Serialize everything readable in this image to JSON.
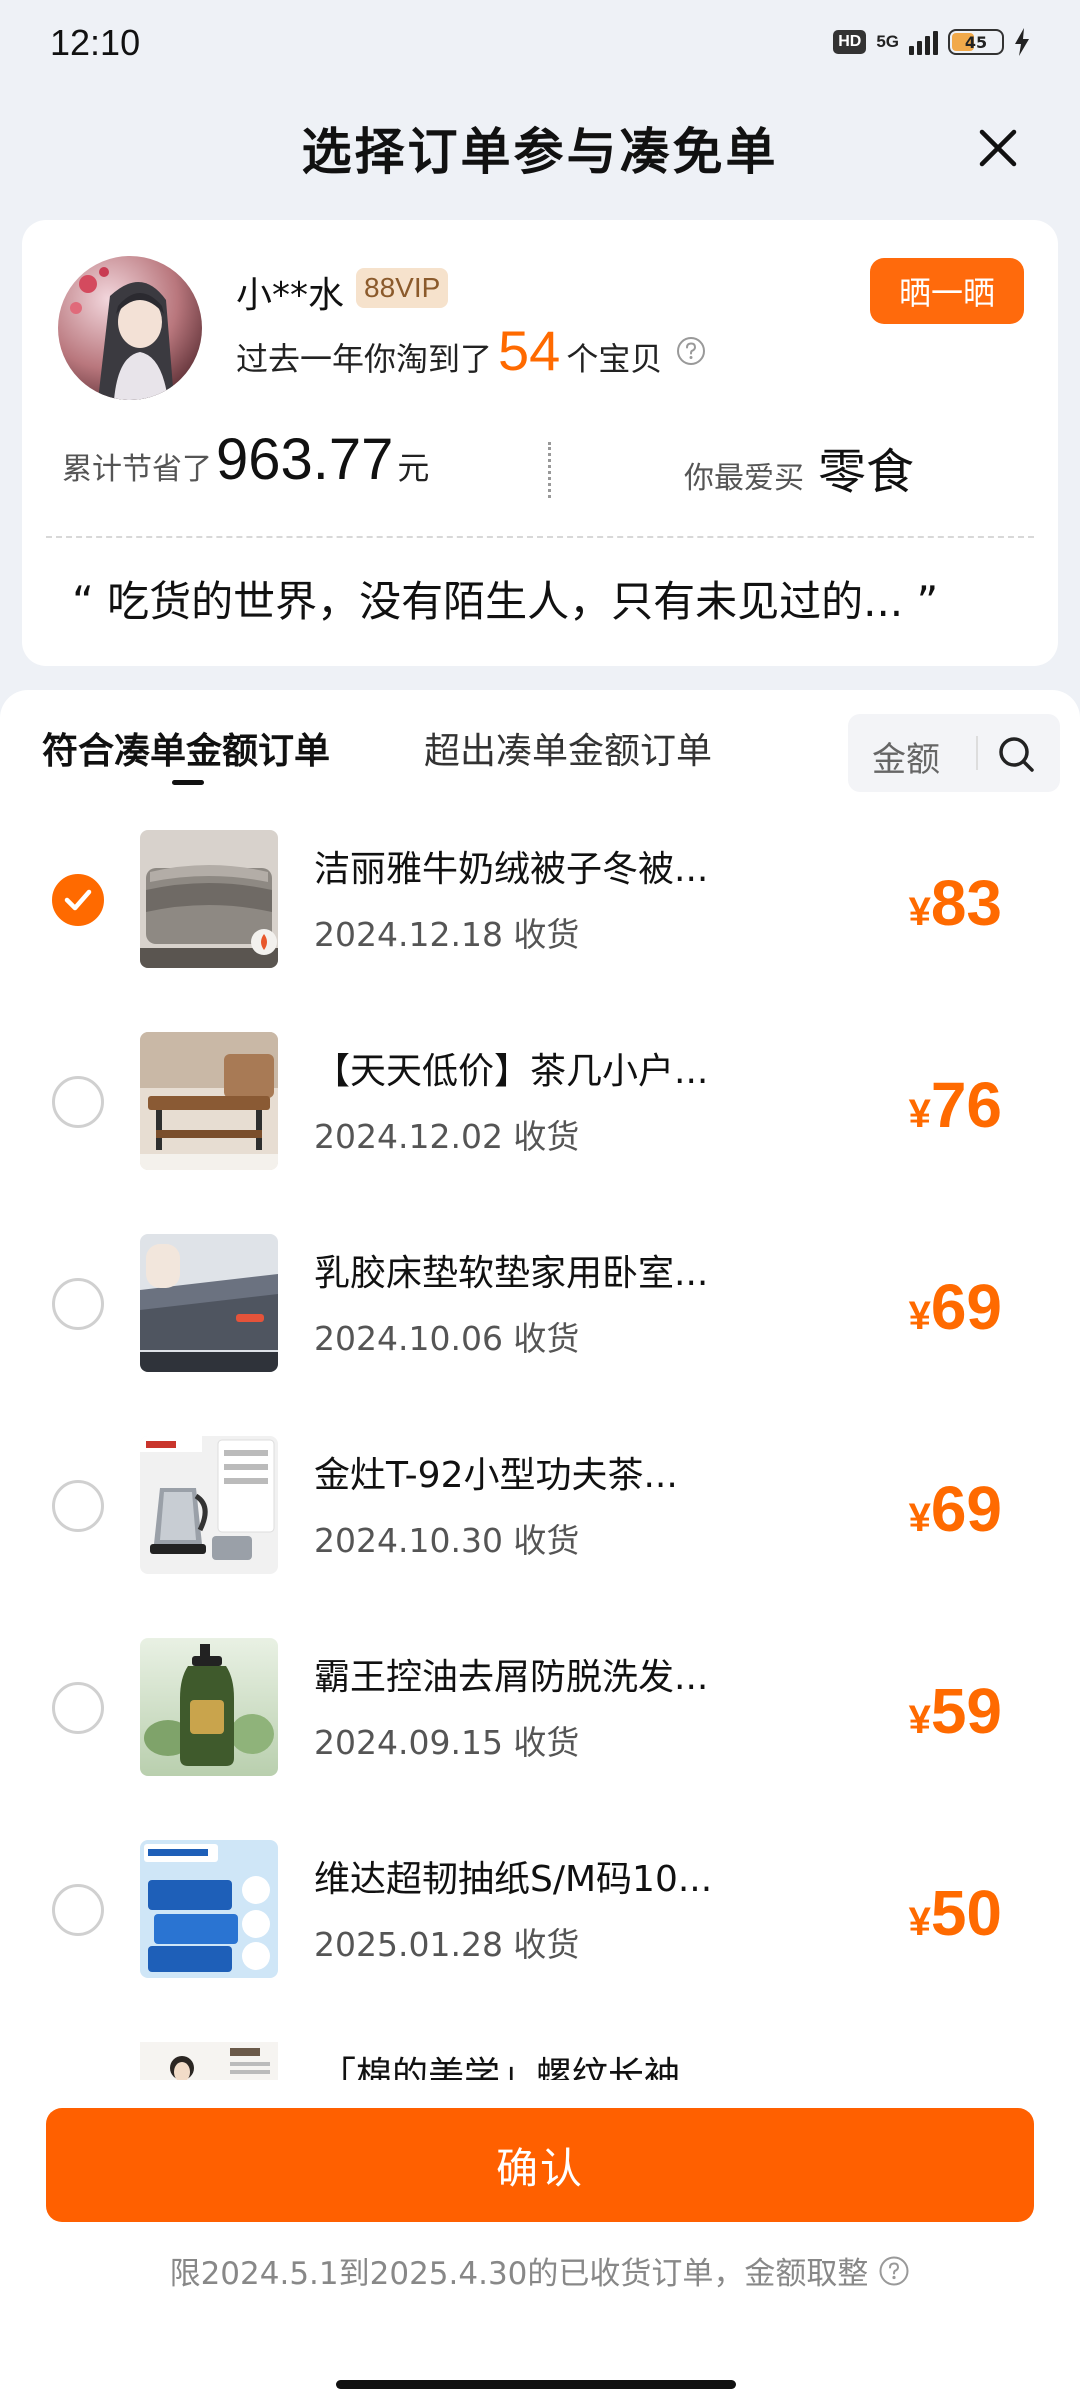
{
  "status_bar": {
    "time": "12:10",
    "hd_label": "HD",
    "network": "5G",
    "battery_level": "45"
  },
  "header": {
    "title": "选择订单参与凑免单"
  },
  "profile": {
    "username": "小**水",
    "vip_badge": "88VIP",
    "share_button": "晒一晒",
    "summary_prefix": "过去一年你淘到了",
    "summary_count": "54",
    "summary_suffix": "个宝贝",
    "saved_label": "累计节省了",
    "saved_amount": "963.77",
    "saved_unit": "元",
    "favorite_label": "你最爱买",
    "favorite_category": "零食",
    "quote": "“ 吃货的世界，没有陌生人，只有未见过的... ”"
  },
  "tabs": [
    {
      "label": "符合凑单金额订单",
      "active": true
    },
    {
      "label": "超出凑单金额订单",
      "active": false
    }
  ],
  "sort": {
    "label": "金额"
  },
  "orders": [
    {
      "title": "洁丽雅牛奶绒被子冬被...",
      "date": "2024.12.18 收货",
      "currency": "¥",
      "price": "83",
      "checked": true
    },
    {
      "title": "【天天低价】茶几小户...",
      "date": "2024.12.02 收货",
      "currency": "¥",
      "price": "76",
      "checked": false
    },
    {
      "title": "乳胶床垫软垫家用卧室...",
      "date": "2024.10.06 收货",
      "currency": "¥",
      "price": "69",
      "checked": false
    },
    {
      "title": "金灶T-92小型功夫茶...",
      "date": "2024.10.30 收货",
      "currency": "¥",
      "price": "69",
      "checked": false
    },
    {
      "title": "霸王控油去屑防脱洗发...",
      "date": "2024.09.15 收货",
      "currency": "¥",
      "price": "59",
      "checked": false
    },
    {
      "title": "维达超韧抽纸S/M码10...",
      "date": "2025.01.28 收货",
      "currency": "¥",
      "price": "50",
      "checked": false
    }
  ],
  "partial_order": {
    "title": "「棉的美学」螺纹长袖"
  },
  "footer": {
    "confirm_button": "确认",
    "note": "限2024.5.1到2025.4.30的已收货订单，金额取整"
  },
  "colors": {
    "accent": "#ff6a00",
    "background": "#eef1f6",
    "card": "#ffffff"
  }
}
